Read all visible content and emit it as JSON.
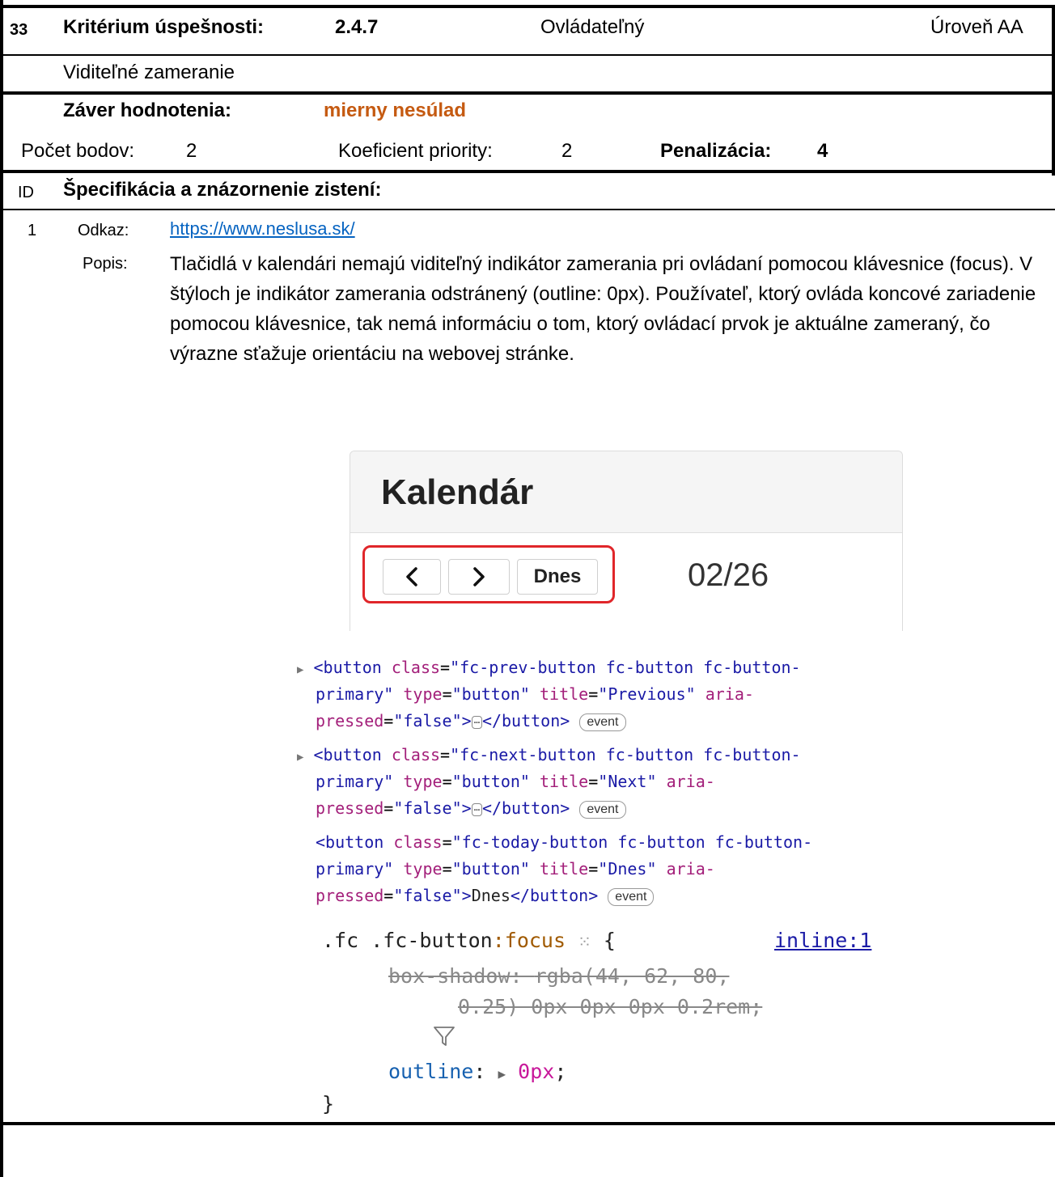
{
  "header": {
    "number": "33",
    "criterion_label": "Kritérium úspešnosti:",
    "criterion_code": "2.4.7",
    "principle": "Ovládateľný",
    "level": "Úroveň AA"
  },
  "criterion_name": "Viditeľné zameranie",
  "evaluation": {
    "label": "Záver hodnotenia:",
    "value": "mierny nesúlad",
    "value_color": "#c55a11"
  },
  "scoring": {
    "points_label": "Počet bodov:",
    "points": "2",
    "priority_label": "Koeficient priority:",
    "priority": "2",
    "penalty_label": "Penalizácia:",
    "penalty": "4"
  },
  "findings_header": {
    "id_label": "ID",
    "title": "Špecifikácia a znázornenie zistení:"
  },
  "finding": {
    "id": "1",
    "link_label": "Odkaz:",
    "url": "https://www.neslusa.sk/",
    "desc_label": "Popis:",
    "description": "Tlačidlá v kalendári nemajú viditeľný indikátor zamerania pri ovládaní pomocou klávesnice (focus). V štýloch je indikátor zamerania odstránený (outline: 0px). Používateľ, ktorý ovláda koncové zariadenie pomocou klávesnice, tak nemá informáciu o tom, ktorý ovládací prvok je aktuálne zameraný, čo výrazne sťažuje orientáciu na webovej stránke."
  },
  "calendar": {
    "title": "Kalendár",
    "prev_icon": "chevron-left-icon",
    "next_icon": "chevron-right-icon",
    "today_label": "Dnes",
    "date": "02/26",
    "highlight_color": "#e0262a"
  },
  "devtools": {
    "buttons": [
      {
        "cls": "fc-prev-button fc-button fc-button-",
        "cls2": "primary",
        "type": "button",
        "title": "Previous",
        "pressed": "false",
        "content": "",
        "collapsed": true,
        "badge": "event"
      },
      {
        "cls": "fc-next-button fc-button fc-button-",
        "cls2": "primary",
        "type": "button",
        "title": "Next",
        "pressed": "false",
        "content": "",
        "collapsed": true,
        "badge": "event"
      },
      {
        "cls": "fc-today-button fc-button fc-button-",
        "cls2": "primary",
        "type": "button",
        "title": "Dnes",
        "pressed": "false",
        "content": "Dnes",
        "collapsed": false,
        "badge": "event"
      }
    ],
    "css": {
      "selector": ".fc .fc-button",
      "pseudo": ":focus",
      "source": "inline:1",
      "struck_prop": "box-shadow",
      "struck_value_1": "rgba(44, 62, 80,",
      "struck_value_2": "0.25) 0px 0px 0px 0.2rem;",
      "prop": "outline",
      "value": "0px"
    }
  }
}
